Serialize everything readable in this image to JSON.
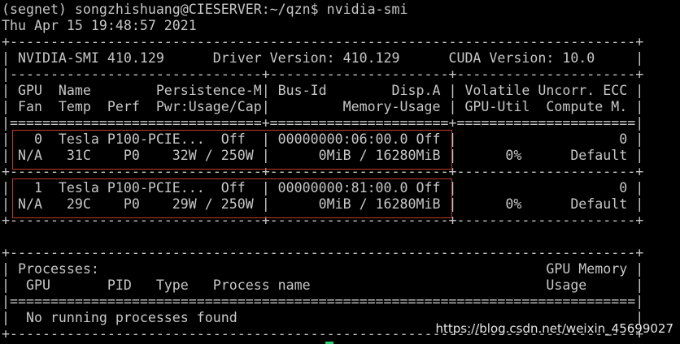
{
  "terminal": {
    "prompt_line": "(segnet) songzhishuang@CIESERVER:~/qzn$ nvidia-smi",
    "date_line": "Thu Apr 15 19:48:57 2021",
    "lines": [
      "+-----------------------------------------------------------------------------+",
      "| NVIDIA-SMI 410.129      Driver Version: 410.129      CUDA Version: 10.0     |",
      "|-------------------------------+----------------------+----------------------+",
      "| GPU  Name        Persistence-M| Bus-Id        Disp.A | Volatile Uncorr. ECC |",
      "| Fan  Temp  Perf  Pwr:Usage/Cap|         Memory-Usage | GPU-Util  Compute M. |",
      "|===============================+======================+======================|",
      "|   0  Tesla P100-PCIE...  Off  | 00000000:06:00.0 Off |                    0 |",
      "| N/A   31C    P0    32W / 250W |      0MiB / 16280MiB |      0%      Default |",
      "+-------------------------------+----------------------+----------------------+",
      "|   1  Tesla P100-PCIE...  Off  | 00000000:81:00.0 Off |                    0 |",
      "| N/A   29C    P0    29W / 250W |      0MiB / 16280MiB |      0%      Default |",
      "+-------------------------------+----------------------+----------------------+",
      "",
      "+-----------------------------------------------------------------------------+",
      "| Processes:                                                       GPU Memory |",
      "|  GPU       PID   Type   Process name                             Usage      |",
      "|=============================================================================|",
      "|  No running processes found                                                 |",
      "+-----------------------------------------------------------------------------+"
    ]
  },
  "gpus": [
    {
      "index": "0",
      "name": "Tesla P100-PCIE...",
      "persistence": "Off",
      "bus_id": "00000000:06:00.0",
      "disp": "Off",
      "ecc": "0",
      "fan": "N/A",
      "temp": "31C",
      "perf": "P0",
      "power": "32W / 250W",
      "memory": "0MiB / 16280MiB",
      "util": "0%",
      "compute_mode": "Default"
    },
    {
      "index": "1",
      "name": "Tesla P100-PCIE...",
      "persistence": "Off",
      "bus_id": "00000000:81:00.0",
      "disp": "Off",
      "ecc": "0",
      "fan": "N/A",
      "temp": "29C",
      "perf": "P0",
      "power": "29W / 250W",
      "memory": "0MiB / 16280MiB",
      "util": "0%",
      "compute_mode": "Default"
    }
  ],
  "watermark": "https://blog.csdn.net/weixin_45699027",
  "colors": {
    "background": "#000000",
    "text": "#c7c7c7",
    "highlight_box": "#c0392b",
    "cursor": "#2ecc71"
  }
}
